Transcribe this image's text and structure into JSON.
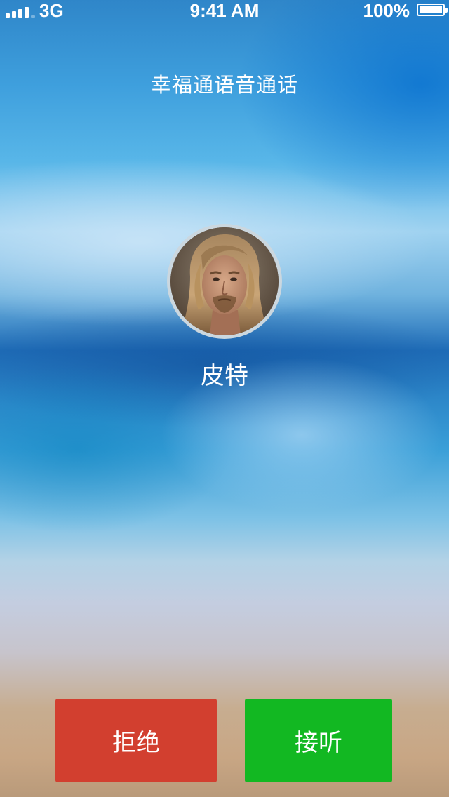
{
  "status_bar": {
    "network": "3G",
    "time": "9:41 AM",
    "battery_percent": "100%",
    "battery_level": 1.0,
    "signal_strength_bars": 4,
    "icons": [
      "signal-icon",
      "battery-icon"
    ]
  },
  "call": {
    "title": "幸福通语音通话",
    "caller_name": "皮特",
    "avatar": "caller-avatar-photo"
  },
  "actions": {
    "decline_label": "拒绝",
    "answer_label": "接听"
  },
  "colors": {
    "decline": "#d23f2f",
    "answer": "#12b822",
    "text": "#ffffff"
  }
}
